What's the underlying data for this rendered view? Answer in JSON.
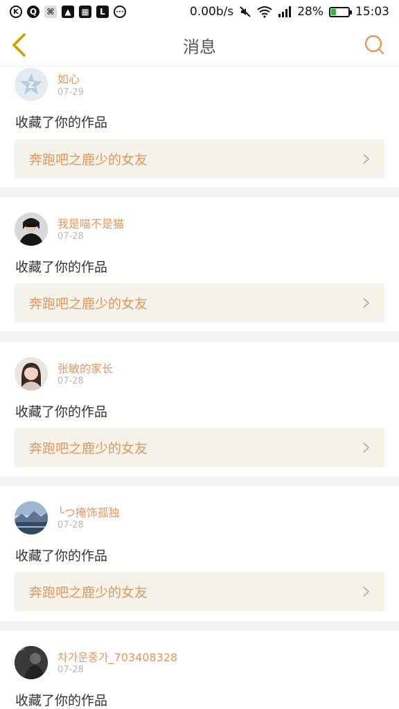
{
  "status_bar": {
    "net_speed": "0.00b/s",
    "battery_percent": "28%",
    "battery_level": 0.28,
    "time": "15:03",
    "left_icons": [
      "k-circle-icon",
      "q-circle-icon",
      "app-icon",
      "image-icon",
      "grid-icon",
      "calendar-icon",
      "more-icon"
    ],
    "right_icons": [
      "mute-icon",
      "wifi-icon",
      "signal-icon",
      "battery-icon"
    ]
  },
  "header": {
    "title": "消息"
  },
  "colors": {
    "accent": "#e8955a",
    "back_icon": "#e0b000",
    "work_bg": "#f3f3ea",
    "divider": "#f3f3f3"
  },
  "messages": [
    {
      "user": "如心",
      "date": "07-29",
      "action": "收藏了你的作品",
      "work_title": "奔跑吧之鹿少的女友"
    },
    {
      "user": "我是喵不是猫",
      "date": "07-28",
      "action": "收藏了你的作品",
      "work_title": "奔跑吧之鹿少的女友"
    },
    {
      "user": "张敏的家长",
      "date": "07-28",
      "action": "收藏了你的作品",
      "work_title": "奔跑吧之鹿少的女友"
    },
    {
      "user": "╰つ掩饰孤独",
      "date": "07-28",
      "action": "收藏了你的作品",
      "work_title": "奔跑吧之鹿少的女友"
    },
    {
      "user": "차가운중가_703408328",
      "date": "07-28",
      "action": "收藏了你的作品"
    }
  ]
}
